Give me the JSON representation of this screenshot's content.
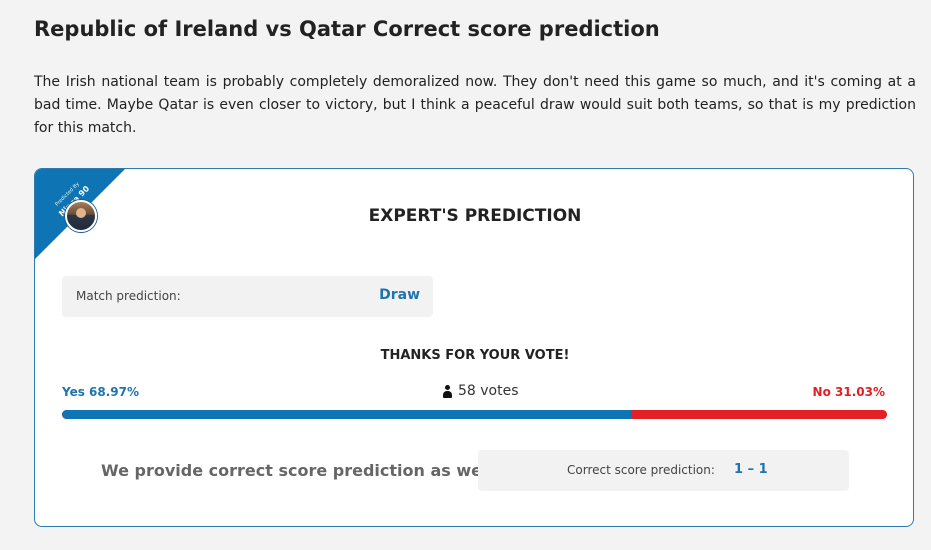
{
  "page": {
    "title": "Republic of Ireland vs Qatar Correct score prediction",
    "intro": "The Irish national team is probably completely demoralized now. They don't need this game so much, and it's coming at a bad time. Maybe Qatar is even closer to victory, but I think a peaceful draw would suit both teams, so that is my prediction for this match."
  },
  "prediction_card": {
    "ribbon": {
      "small_text": "Predicted By",
      "name": "Ninca 90"
    },
    "title": "EXPERT'S PREDICTION",
    "match_prediction_label": "Match prediction:",
    "match_prediction_value": "Draw",
    "vote": {
      "thanks": "THANKS FOR YOUR VOTE!",
      "yes_label": "Yes 68.97%",
      "no_label": "No 31.03%",
      "votes_text": "58 votes",
      "yes_percent": 68.97,
      "no_percent": 31.03,
      "colors": {
        "yes": "#0f74b4",
        "no": "#e32026"
      }
    },
    "correct_score": {
      "lead": "We provide correct score prediction as well:",
      "label": "Correct score prediction:",
      "value": "1 – 1"
    }
  },
  "icons": {
    "voter_icon": "user-icon",
    "avatar": "expert-avatar"
  },
  "colors": {
    "accent": "#1f74ad",
    "border": "#2d7ab0",
    "page_background": "#f3f3f3",
    "card_background": "#ffffff"
  }
}
